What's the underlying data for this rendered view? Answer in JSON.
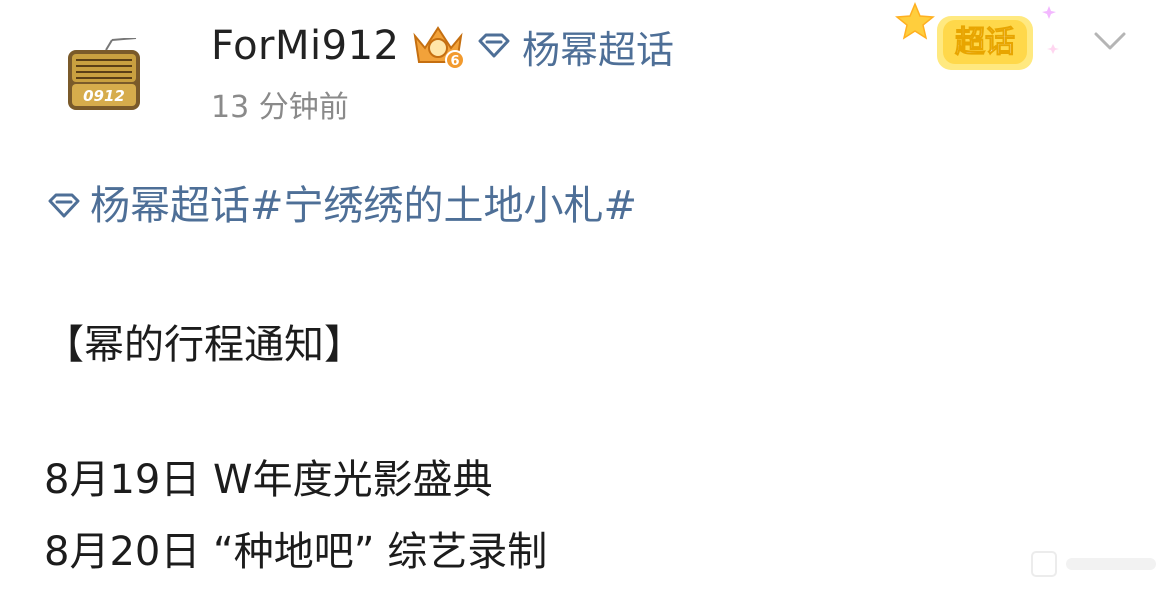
{
  "post": {
    "username": "ForMi912",
    "level_badge": "6",
    "super_topic": "杨幂超话",
    "timestamp": "13 分钟前",
    "chaohua_badge": "超话",
    "avatar_label": "0912",
    "content": {
      "tag_topic": "杨幂超话",
      "tag_hashtag": "#宁绣绣的土地小札#",
      "heading": "【幂的行程通知】",
      "schedule": [
        "8月19日 W年度光影盛典",
        "8月20日 “种地吧” 综艺录制"
      ]
    }
  },
  "colors": {
    "link": "#4e6f97",
    "text": "#1c1c1c",
    "muted": "#8a8a8a",
    "badge_yellow": "#ffd84a"
  },
  "icons": [
    "radio-avatar-icon",
    "crown-level-icon",
    "diamond-topic-icon",
    "chaohua-star-icon",
    "chevron-down-icon"
  ]
}
